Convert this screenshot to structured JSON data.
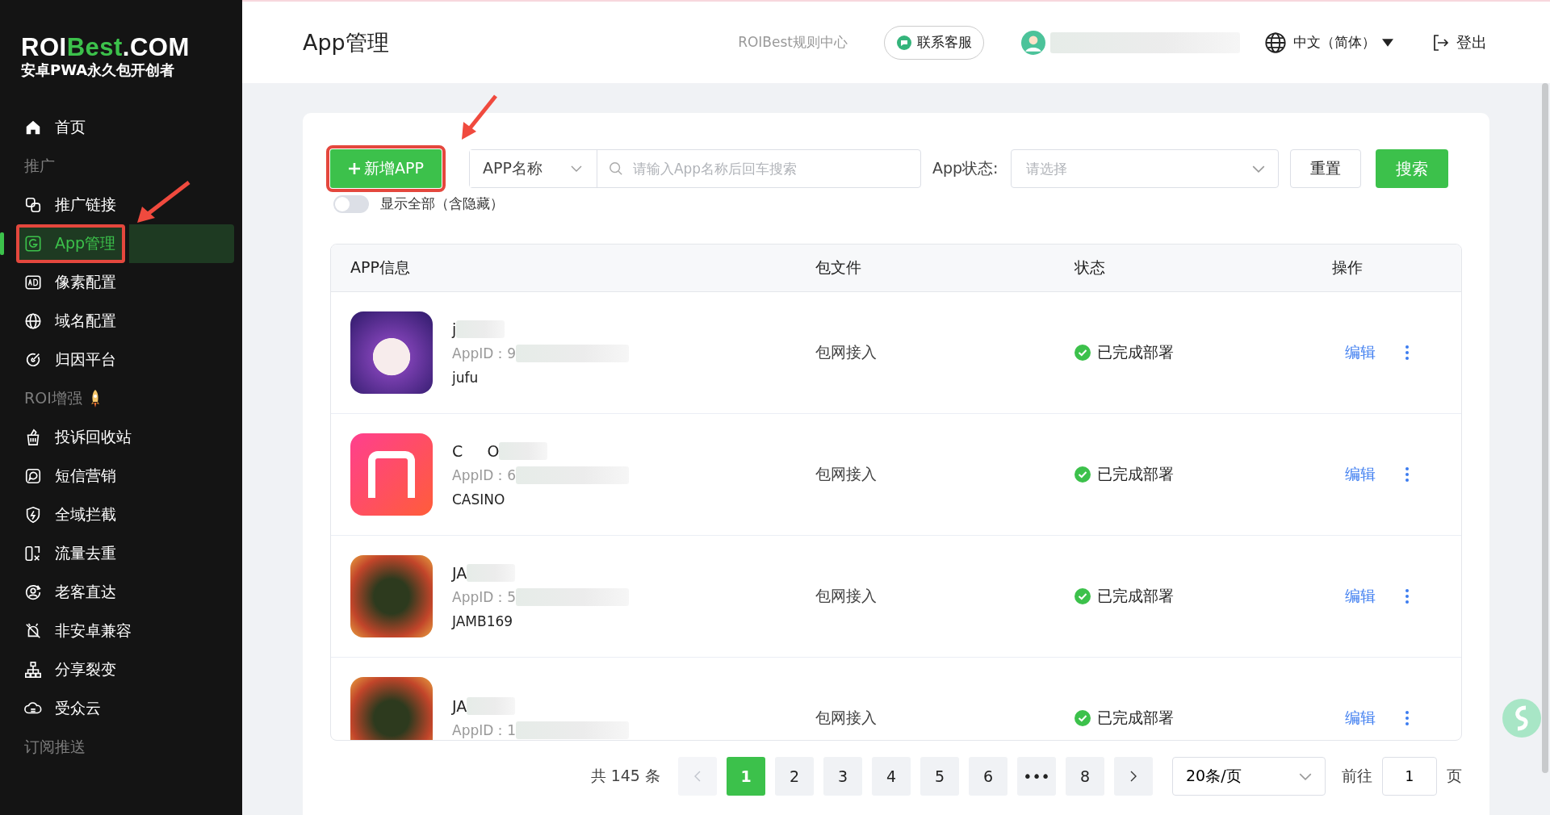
{
  "sidebar": {
    "logo": {
      "brand_main": "ROI",
      "brand_accent": "Best",
      "brand_suffix": ".COM",
      "tagline": "安卓PWA永久包开创者"
    },
    "items": [
      {
        "kind": "item",
        "label": "首页",
        "selected": false
      },
      {
        "kind": "section",
        "label": "推广"
      },
      {
        "kind": "item",
        "label": "推广链接",
        "selected": false
      },
      {
        "kind": "item",
        "label": "App管理",
        "selected": true
      },
      {
        "kind": "item",
        "label": "像素配置",
        "selected": false
      },
      {
        "kind": "item",
        "label": "域名配置",
        "selected": false
      },
      {
        "kind": "item",
        "label": "归因平台",
        "selected": false
      },
      {
        "kind": "section",
        "label": "ROI增强",
        "rocket": true
      },
      {
        "kind": "item",
        "label": "投诉回收站",
        "selected": false
      },
      {
        "kind": "item",
        "label": "短信营销",
        "selected": false
      },
      {
        "kind": "item",
        "label": "全域拦截",
        "selected": false
      },
      {
        "kind": "item",
        "label": "流量去重",
        "selected": false
      },
      {
        "kind": "item",
        "label": "老客直达",
        "selected": false
      },
      {
        "kind": "item",
        "label": "非安卓兼容",
        "selected": false
      },
      {
        "kind": "item",
        "label": "分享裂变",
        "selected": false
      },
      {
        "kind": "item",
        "label": "受众云",
        "selected": false
      },
      {
        "kind": "section",
        "label": "订阅推送"
      }
    ]
  },
  "header": {
    "title": "App管理",
    "rules_link": "ROIBest规则中心",
    "support_button": "联系客服",
    "language": "中文（简体）",
    "logout": "登出"
  },
  "toolbar": {
    "add_button": "新增APP",
    "search_type": "APP名称",
    "search": {
      "placeholder": "请输入App名称后回车搜索"
    },
    "status_label": "App状态:",
    "status_select": {
      "placeholder": "请选择"
    },
    "reset_button": "重置",
    "search_button": "搜索",
    "show_all": {
      "label": "显示全部（含隐藏）",
      "on": false
    }
  },
  "table": {
    "columns": [
      "APP信息",
      "包文件",
      "状态",
      "操作"
    ],
    "rows": [
      {
        "name": "j",
        "app_id": "AppID：9",
        "tag": "jufu",
        "package": "包网接入",
        "status": "已完成部署",
        "edit": "编辑",
        "kind": "rabbit"
      },
      {
        "name": "C     O",
        "app_id": "AppID：6",
        "tag": "CASINO",
        "package": "包网接入",
        "status": "已完成部署",
        "edit": "编辑",
        "kind": "letter"
      },
      {
        "name": "JA",
        "app_id": "AppID：5",
        "tag": "JAMB169",
        "package": "包网接入",
        "status": "已完成部署",
        "edit": "编辑",
        "kind": "game"
      },
      {
        "name": "JA",
        "app_id": "AppID：1",
        "package": "包网接入",
        "status": "已完成部署",
        "edit": "编辑",
        "kind": "game"
      }
    ]
  },
  "pagination": {
    "total": "共 145 条",
    "pages": [
      {
        "label": "1",
        "selected": true
      },
      {
        "label": "2",
        "selected": false
      },
      {
        "label": "3",
        "selected": false
      },
      {
        "label": "4",
        "selected": false
      },
      {
        "label": "5",
        "selected": false
      },
      {
        "label": "6",
        "selected": false
      },
      {
        "label": "•••",
        "selected": false
      },
      {
        "label": "8",
        "selected": false
      }
    ],
    "page_size": "20条/页",
    "goto_label": "前往",
    "goto_value": "1",
    "page_suffix": "页"
  }
}
